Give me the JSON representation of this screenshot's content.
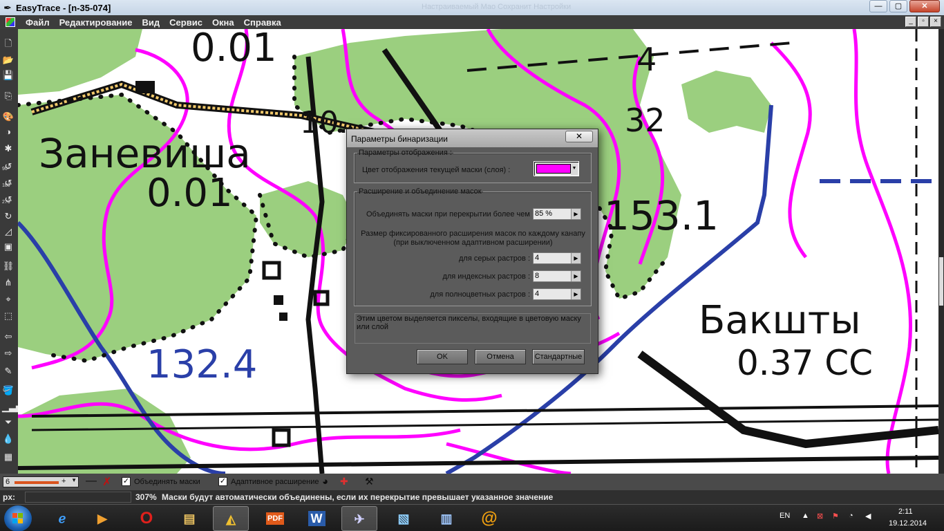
{
  "window": {
    "title": "EasyTrace - [n-35-074]",
    "ghost_title": "Настраиваемый Мао Сохранит Настройки",
    "buttons": {
      "minimize": "—",
      "maximize": "▢",
      "close": "✕"
    }
  },
  "menu": {
    "items": [
      "Файл",
      "Редактирование",
      "Вид",
      "Сервис",
      "Окна",
      "Справка"
    ],
    "mdi_buttons": [
      "_",
      "▫",
      "×"
    ]
  },
  "toolbar": {
    "rotate_labels": [
      "90°",
      "180°",
      "270°"
    ]
  },
  "map": {
    "labels": {
      "zanevisha": "Заневиша",
      "baksht": "Бакшты",
      "val_001_a": "0.01",
      "val_001_b": "0.01",
      "val_10": "10.",
      "val_4": "4",
      "val_32": "32",
      "val_1531": "153.1",
      "val_1324": "132.4",
      "val_037": "0.37 СС"
    }
  },
  "dialog": {
    "title": "Параметры бинаризации",
    "close": "✕",
    "group_display": {
      "legend": "Параметры отображения :",
      "color_label": "Цвет отображения текущей маски (слоя) :",
      "color_value": "#ff00ff"
    },
    "group_expand": {
      "legend": "Расширение и объединение масок",
      "merge_label": "Объединять маски при перекрытии более чем",
      "merge_value": "85 %",
      "fixed_desc": "Размер фиксированного расширения масок по каждому канапу (при выключенном адаптивном расширении)",
      "gray_label": "для серых растров :",
      "gray_value": "4",
      "index_label": "для индексных растров :",
      "index_value": "8",
      "full_label": "для полноцветных растров :",
      "full_value": "4"
    },
    "hint": "Этим цветом выделяется пикселы, входящие в цветовую маску или слой",
    "buttons": {
      "ok": "OK",
      "cancel": "Отмена",
      "defaults": "Стандартные"
    }
  },
  "options_bar": {
    "line_width": "6",
    "plus": "+",
    "merge_masks_label": "Объединять маски",
    "merge_masks_checked": "✓",
    "adaptive_label": "Адаптивное расширение",
    "adaptive_checked": "✓"
  },
  "status_bar": {
    "coords_label": "px:",
    "zoom": "307%",
    "message": "Маски будут автоматически объединены, если их перекрытие превышает указанное значение"
  },
  "taskbar": {
    "apps": [
      "internet-explorer",
      "media-player",
      "opera",
      "file-explorer",
      "easytrace",
      "pdf",
      "word",
      "telegram-like",
      "image-viewer",
      "network-tool",
      "mail"
    ],
    "pdf_label": "PDF",
    "word_label": "W",
    "lang": "EN",
    "time": "2:11",
    "date": "19.12.2014"
  },
  "colors": {
    "map_green": "#9bcf7f",
    "map_magenta": "#ff00ff",
    "map_blue": "#2a3fa8",
    "dialog_bg": "#5b5b5b"
  }
}
